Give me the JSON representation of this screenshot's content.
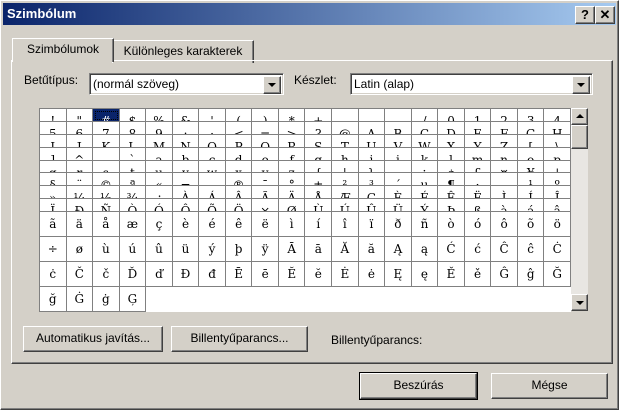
{
  "window": {
    "title": "Szimbólum"
  },
  "titlebar_buttons": {
    "help": "?",
    "close": "✕"
  },
  "tabs": [
    {
      "label": "Szimbólumok",
      "active": true
    },
    {
      "label": "Különleges karakterek",
      "active": false
    }
  ],
  "font": {
    "label": "Betűtípus:",
    "value": "(normál szöveg)"
  },
  "subset": {
    "label": "Készlet:",
    "value": "Latin (alap)"
  },
  "symbols": [
    "!",
    "\"",
    "#",
    "$",
    "%",
    "&",
    "'",
    "(",
    ")",
    "*",
    "+",
    ",",
    "-",
    ".",
    "/",
    "0",
    "1",
    "2",
    "3",
    "4",
    "5",
    "6",
    "7",
    "8",
    "9",
    ":",
    ";",
    "<",
    "=",
    ">",
    "?",
    "@",
    "A",
    "B",
    "C",
    "D",
    "E",
    "F",
    "G",
    "H",
    "I",
    "J",
    "K",
    "L",
    "M",
    "N",
    "O",
    "P",
    "Q",
    "R",
    "S",
    "T",
    "U",
    "V",
    "W",
    "X",
    "Y",
    "Z",
    "[",
    "\\",
    "]",
    "^",
    "_",
    "`",
    "a",
    "b",
    "c",
    "d",
    "e",
    "f",
    "g",
    "h",
    "i",
    "j",
    "k",
    "l",
    "m",
    "n",
    "o",
    "p",
    "q",
    "r",
    "s",
    "t",
    "u",
    "v",
    "w",
    "x",
    "y",
    "z",
    "{",
    "|",
    "}",
    "~",
    "¡",
    "¢",
    "£",
    "¤",
    "¥",
    "¦",
    "§",
    "¨",
    "©",
    "ª",
    "«",
    "¬",
    "-",
    "®",
    "¯",
    "°",
    "±",
    "²",
    "³",
    "´",
    "µ",
    "¶",
    "·",
    "¸",
    "¹",
    "º",
    "»",
    "¼",
    "½",
    "¾",
    "¿",
    "À",
    "Á",
    "Â",
    "Ã",
    "Ä",
    "Å",
    "Æ",
    "Ç",
    "È",
    "É",
    "Ê",
    "Ë",
    "Ì",
    "Í",
    "Î",
    "Ï",
    "Ð",
    "Ñ",
    "Ò",
    "Ó",
    "Ô",
    "Õ",
    "Ö",
    "×",
    "Ø",
    "Ù",
    "Ú",
    "Û",
    "Ü",
    "Ý",
    "Þ",
    "ß",
    "à",
    "á",
    "â",
    "ã",
    "ä",
    "å",
    "æ",
    "ç",
    "è",
    "é",
    "ê",
    "ë",
    "ì",
    "í",
    "î",
    "ï",
    "ð",
    "ñ",
    "ò",
    "ó",
    "ô",
    "õ",
    "ö",
    "÷",
    "ø",
    "ù",
    "ú",
    "û",
    "ü",
    "ý",
    "þ",
    "ÿ",
    "Ā",
    "ā",
    "Ă",
    "ă",
    "Ą",
    "ą",
    "Ć",
    "ć",
    "Ĉ",
    "ĉ",
    "Ċ",
    "ċ",
    "Č",
    "č",
    "Ď",
    "ď",
    "Đ",
    "đ",
    "Ē",
    "ē",
    "Ĕ",
    "ĕ",
    "Ė",
    "ė",
    "Ę",
    "ę",
    "Ě",
    "ě",
    "Ĝ",
    "ĝ",
    "Ğ",
    "ğ",
    "Ġ",
    "ġ",
    "Ģ"
  ],
  "selected_symbol": "#",
  "buttons": {
    "autocorrect": "Automatikus javítás...",
    "shortcut_key": "Billentyűparancs...",
    "insert": "Beszúrás",
    "cancel": "Mégse"
  },
  "shortcut_info": "Billentyűparancs:"
}
